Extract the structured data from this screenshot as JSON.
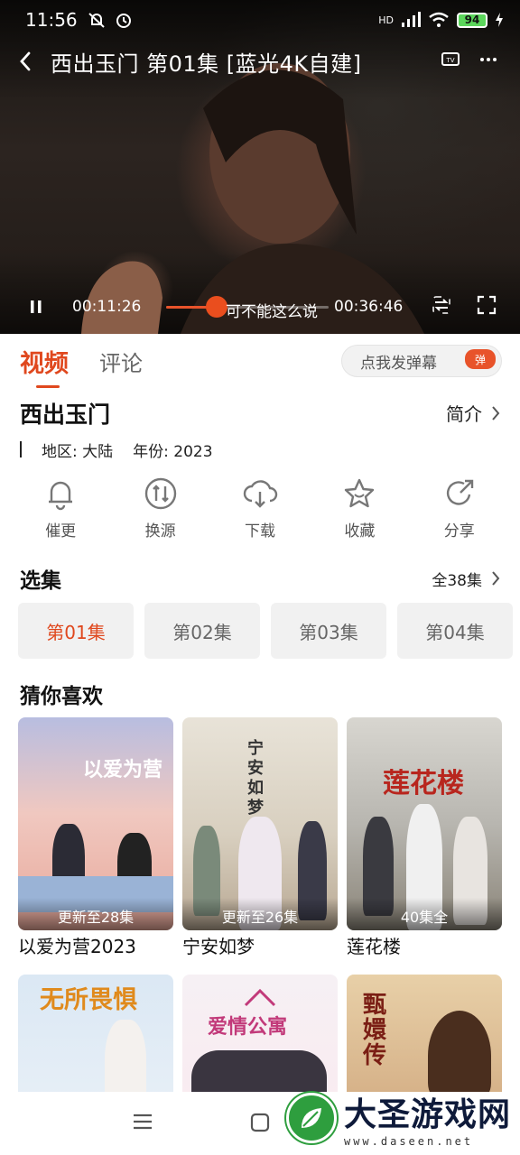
{
  "status_bar": {
    "time": "11:56",
    "network": "HD",
    "battery": "94"
  },
  "player": {
    "title": "西出玉门 第01集 [蓝光4K自建]",
    "current_time": "00:11:26",
    "duration": "00:36:46",
    "subtitle": "可不能这么说",
    "progress_fraction": 0.311
  },
  "tabs": {
    "video": "视频",
    "comment": "评论",
    "danmu_placeholder": "点我发弹幕",
    "danmu_badge": "弹"
  },
  "show": {
    "title": "西出玉门",
    "intro_label": "简介",
    "region": "地区: 大陆",
    "year": "年份: 2023"
  },
  "actions": [
    {
      "label": "催更",
      "icon": "bell-icon"
    },
    {
      "label": "换源",
      "icon": "switch-source-icon"
    },
    {
      "label": "下载",
      "icon": "cloud-download-icon"
    },
    {
      "label": "收藏",
      "icon": "star-icon"
    },
    {
      "label": "分享",
      "icon": "share-icon"
    }
  ],
  "episodes": {
    "heading": "选集",
    "total_label": "全38集",
    "items": [
      "第01集",
      "第02集",
      "第03集",
      "第04集"
    ],
    "active_index": 0
  },
  "recommend": {
    "heading": "猜你喜欢",
    "items": [
      {
        "name": "以爱为营2023",
        "badge": "更新至28集",
        "poster_text": "以爱为营"
      },
      {
        "name": "宁安如梦",
        "badge": "更新至26集",
        "poster_text": "宁安如梦"
      },
      {
        "name": "莲花楼",
        "badge": "40集全",
        "poster_text": "莲花楼"
      },
      {
        "name": "",
        "badge": "",
        "poster_text": "无所畏惧"
      },
      {
        "name": "",
        "badge": "",
        "poster_text": "爱情公寓"
      },
      {
        "name": "",
        "badge": "",
        "poster_text": "甄嬛传"
      }
    ]
  },
  "watermark": {
    "title": "大圣游戏网",
    "url": "www.daseen.net"
  },
  "colors": {
    "accent": "#e0481e",
    "progress": "#ea4e1e"
  }
}
